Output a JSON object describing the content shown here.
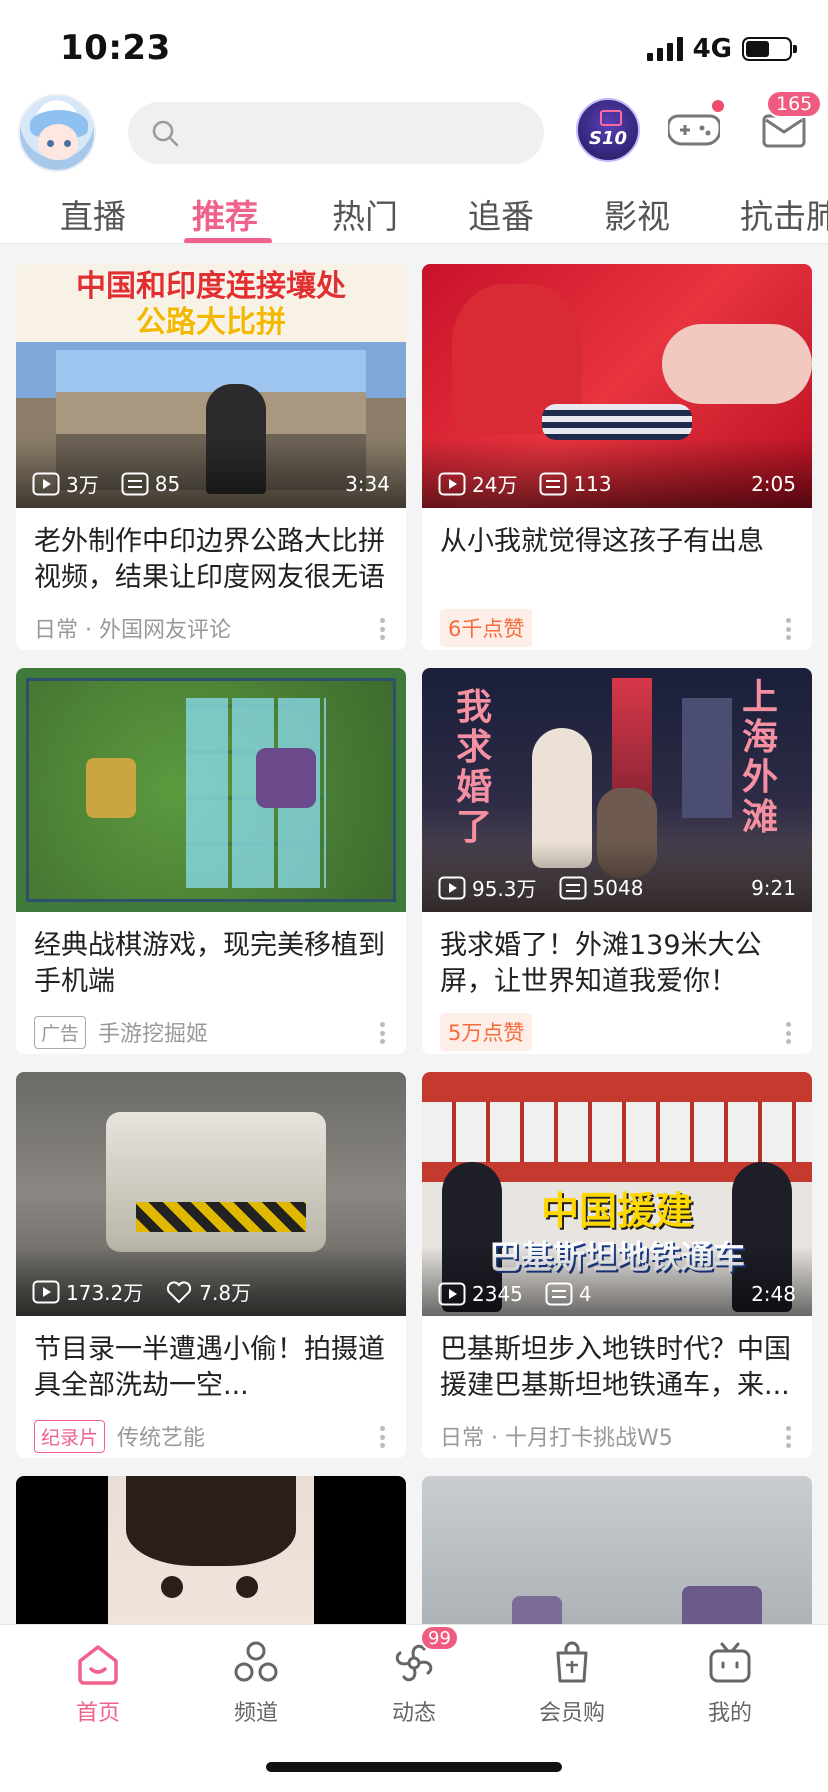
{
  "status_bar": {
    "time": "10:23",
    "network": "4G"
  },
  "header": {
    "search_placeholder": "",
    "promo_badge": "S10",
    "mail_badge": "165"
  },
  "tabs": [
    {
      "label": "直播"
    },
    {
      "label": "推荐"
    },
    {
      "label": "热门"
    },
    {
      "label": "追番"
    },
    {
      "label": "影视"
    },
    {
      "label": "抗击肺"
    }
  ],
  "active_tab": "推荐",
  "feed": [
    {
      "thumb_overlay_line1": "中国和印度连接壤处",
      "thumb_overlay_line2": "公路大比拼",
      "plays": "3万",
      "danmaku": "85",
      "duration": "3:34",
      "title": "老外制作中印边界公路大比拼视频，结果让印度网友很无语",
      "meta_text": "日常 · 外国网友评论"
    },
    {
      "plays": "24万",
      "danmaku": "113",
      "duration": "2:05",
      "title": "从小我就觉得这孩子有出息",
      "likes_pill": "6千点赞"
    },
    {
      "plays": "",
      "danmaku": "",
      "duration": "",
      "title": "经典战棋游戏，现完美移植到手机端",
      "ad_tag": "广告",
      "meta_text": "手游挖掘姬"
    },
    {
      "thumb_overlay_left": "我求婚了",
      "thumb_overlay_right": "上海外滩",
      "plays": "95.3万",
      "danmaku": "5048",
      "duration": "9:21",
      "title": "我求婚了！外滩139米大公屏，让世界知道我爱你！",
      "likes_pill": "5万点赞"
    },
    {
      "plays": "173.2万",
      "likes": "7.8万",
      "title": "节目录一半遭遇小偷！拍摄道具全部洗劫一空...",
      "category_tag": "纪录片",
      "meta_text": "传统艺能"
    },
    {
      "thumb_overlay_line1": "中国援建",
      "thumb_overlay_line2": "巴基斯坦地铁通车",
      "plays": "2345",
      "danmaku": "4",
      "duration": "2:48",
      "title": "巴基斯坦步入地铁时代？中国援建巴基斯坦地铁通车，来...",
      "meta_text": "日常 · 十月打卡挑战W5"
    }
  ],
  "bottom_nav": [
    {
      "label": "首页",
      "icon": "home-icon"
    },
    {
      "label": "频道",
      "icon": "channel-icon"
    },
    {
      "label": "动态",
      "icon": "dynamic-icon",
      "badge": "99"
    },
    {
      "label": "会员购",
      "icon": "shop-icon"
    },
    {
      "label": "我的",
      "icon": "tv-icon"
    }
  ],
  "colors": {
    "accent": "#f0628c",
    "badge": "#f05a7e",
    "likes_pill": "#f76a3c"
  }
}
